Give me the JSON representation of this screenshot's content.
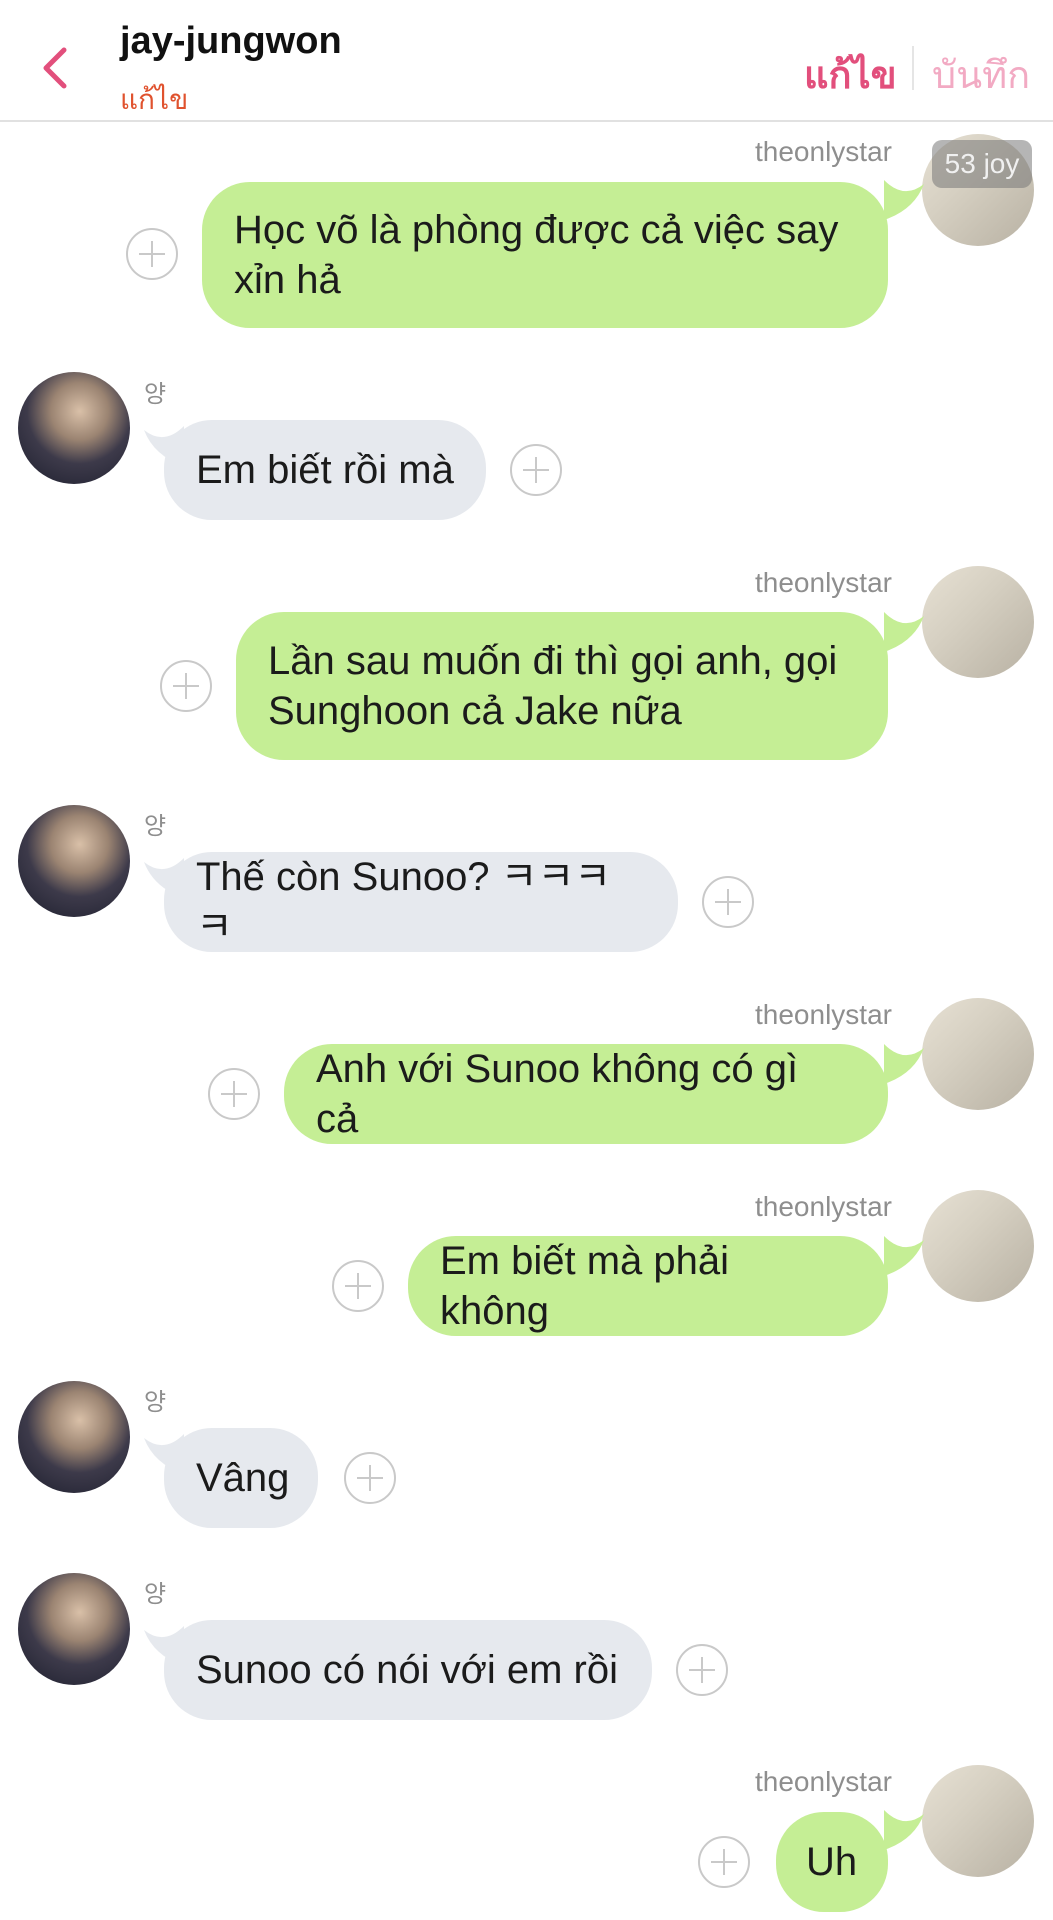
{
  "header": {
    "title": "jay-jungwon",
    "subtitle": "แก้ไข",
    "edit_label": "แก้ไข",
    "save_label": "บันทึก"
  },
  "badge": "53 joy",
  "me_name": "theonlystar",
  "other_name": "양",
  "messages": [
    {
      "sender": "me",
      "text": "Học võ là phòng được cả việc say xỉn hả"
    },
    {
      "sender": "other",
      "text": "Em biết rồi mà"
    },
    {
      "sender": "me",
      "text": "Lần sau muốn đi thì gọi anh, gọi Sunghoon cả Jake nữa"
    },
    {
      "sender": "other",
      "text": "Thế còn Sunoo? ㅋㅋㅋㅋ"
    },
    {
      "sender": "me",
      "text": "Anh với Sunoo không có gì cả"
    },
    {
      "sender": "me",
      "text": "Em biết mà phải không"
    },
    {
      "sender": "other",
      "text": "Vâng"
    },
    {
      "sender": "other",
      "text": "Sunoo có nói với em rồi"
    },
    {
      "sender": "me",
      "text": "Uh"
    }
  ],
  "colors": {
    "accent": "#e24f7c",
    "me_bubble": "#c5ee95",
    "other_bubble": "#e6e9ee"
  },
  "icons": {
    "back": "chevron-left-icon",
    "add": "plus-circle-icon"
  }
}
